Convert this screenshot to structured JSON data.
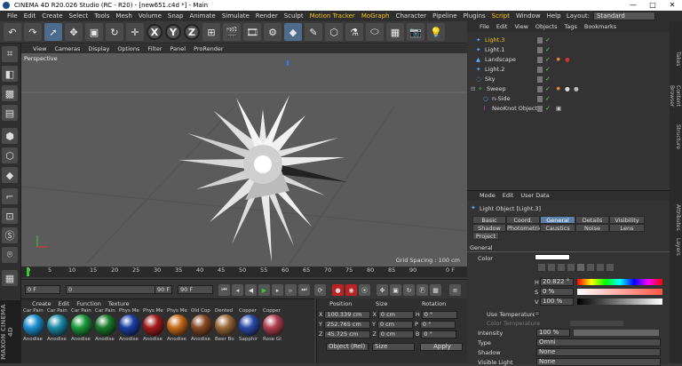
{
  "window": {
    "title": "CINEMA 4D R20.026 Studio (RC - R20) - [new651.c4d *] - Main",
    "min": "—",
    "max": "□",
    "close": "✕"
  },
  "menu": [
    "File",
    "Edit",
    "Create",
    "Select",
    "Tools",
    "Mesh",
    "Volume",
    "Snap",
    "Animate",
    "Simulate",
    "Render",
    "Sculpt",
    "Motion Tracker",
    "MoGraph",
    "Character",
    "Pipeline",
    "Plugins",
    "Script",
    "Window",
    "Help"
  ],
  "layout": {
    "label": "Layout:",
    "value": "Standard"
  },
  "viewport": {
    "menu": [
      "View",
      "Cameras",
      "Display",
      "Options",
      "Filter",
      "Panel",
      "ProRender"
    ],
    "label": "Perspective",
    "grid_spacing": "Grid Spacing : 100 cm"
  },
  "timeline": {
    "ticks": [
      "0",
      "5",
      "10",
      "15",
      "20",
      "25",
      "30",
      "35",
      "40",
      "45",
      "50",
      "55",
      "60",
      "65",
      "70",
      "75",
      "80",
      "85",
      "90"
    ],
    "end_label": "0 F"
  },
  "transport": {
    "start": "0 F",
    "current": "0",
    "max": "90 F",
    "end": "90 F"
  },
  "materials": {
    "tabs": [
      "Create",
      "Edit",
      "Function",
      "Texture"
    ],
    "items": [
      {
        "label": "Car Pain",
        "name": "Anodise",
        "color": "#1b8fd0"
      },
      {
        "label": "Car Pain",
        "name": "Anodise",
        "color": "#1a8aa5"
      },
      {
        "label": "Car Pain",
        "name": "Anodise",
        "color": "#1a9a3a"
      },
      {
        "label": "Car Pain",
        "name": "Anodise",
        "color": "#1a7a2a"
      },
      {
        "label": "Phys Me",
        "name": "Anodise",
        "color": "#1c3fa5"
      },
      {
        "label": "Phys Me",
        "name": "Anodise",
        "color": "#a51c1c"
      },
      {
        "label": "Phys Me",
        "name": "Anodise",
        "color": "#c86a1a"
      },
      {
        "label": "Old Cop",
        "name": "Anodise",
        "color": "#8a4a22"
      },
      {
        "label": "Dented",
        "name": "Beer Bo",
        "color": "#9a6a3a"
      },
      {
        "label": "Copper",
        "name": "Sapphir",
        "color": "#2a4aa8"
      },
      {
        "label": "Copper",
        "name": "Rose Gl",
        "color": "#b24050"
      }
    ]
  },
  "coords": {
    "headers": [
      "Position",
      "Size",
      "Rotation"
    ],
    "rows": [
      {
        "axis": "X",
        "pos": "100.339 cm",
        "size_axis": "X",
        "size": "0 cm",
        "rot_axis": "H",
        "rot": "0 °"
      },
      {
        "axis": "Y",
        "pos": "252.765 cm",
        "size_axis": "Y",
        "size": "0 cm",
        "rot_axis": "P",
        "rot": "0 °"
      },
      {
        "axis": "Z",
        "pos": "45.725 cm",
        "size_axis": "Z",
        "size": "0 cm",
        "rot_axis": "B",
        "rot": "0 °"
      }
    ],
    "mode": "Object (Rel)",
    "size_mode": "Size",
    "apply": "Apply"
  },
  "objects": {
    "menu": [
      "File",
      "Edit",
      "View",
      "Objects",
      "Tags",
      "Bookmarks"
    ],
    "items": [
      {
        "name": "Light.3",
        "selected": true,
        "indent": 0
      },
      {
        "name": "Light.1",
        "indent": 0
      },
      {
        "name": "Landscape",
        "indent": 0
      },
      {
        "name": "Light.2",
        "indent": 0
      },
      {
        "name": "Sky",
        "indent": 0
      },
      {
        "name": "Sweep",
        "indent": 0
      },
      {
        "name": "n-Side",
        "indent": 1
      },
      {
        "name": "NeoKnot Object",
        "indent": 1
      }
    ]
  },
  "attributes": {
    "menu": [
      "Mode",
      "Edit",
      "User Data"
    ],
    "object_label": "Light Object [Light.3]",
    "tabs_row1": [
      "Basic",
      "Coord.",
      "General",
      "Details",
      "Visibility"
    ],
    "tabs_row2": [
      "Shadow",
      "Photometric",
      "Caustics",
      "Noise",
      "Lens"
    ],
    "tabs_row3": [
      "Project"
    ],
    "section": "General",
    "color_label": "Color",
    "h_label": "H",
    "h_value": "20.822 °",
    "s_label": "S",
    "s_value": "0 %",
    "v_label": "V",
    "v_value": "100 %",
    "use_temp": "Use Temperature",
    "color_temp": "Color Temperature",
    "intensity_label": "Intensity",
    "intensity": "100 %",
    "type_label": "Type",
    "type": "Omni",
    "shadow_label": "Shadow",
    "shadow": "None",
    "visible_label": "Visible Light",
    "visible": "None"
  },
  "sidetabs": [
    "Attributes",
    "Layers",
    "Structure",
    "Content Browser",
    "Takes"
  ],
  "brand": "MAXON CINEMA 4D"
}
